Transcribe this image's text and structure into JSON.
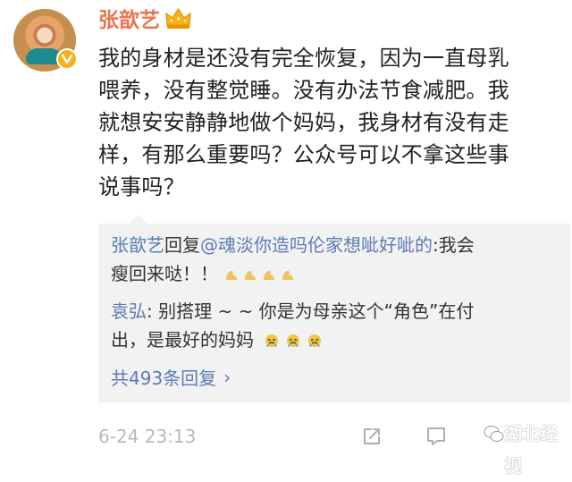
{
  "author": {
    "name": "张歆艺"
  },
  "post": {
    "line1": "我的身材是还没有完全恢复，因为一直母乳",
    "line2": "喂养，没有整觉睡。没有办法节食减肥。我",
    "line3": "就想安安静静地做个妈妈，我身材有没有走",
    "line4": "样，有那么重要吗？公众号可以不拿这些事",
    "line5": "说事吗？"
  },
  "replies": {
    "r1_name": "张歆艺",
    "r1_text": "回复",
    "r1_mention": "@魂淡你造吗伦家想呲好呲的",
    "r1_text2": ":我会",
    "r1_line2": "瘦回来哒！！",
    "r2_name": "袁弘",
    "r2_text": ": 别搭理 ~ ~ 你是为母亲这个“角色”在付",
    "r2_line2": "出，是最好的妈妈",
    "more": "共493条回复"
  },
  "footer": {
    "timestamp": "6-24 23:13"
  },
  "watermark": {
    "text": "湖北经视"
  },
  "colors": {
    "username": "#eb7350",
    "link": "#5b7bb8",
    "reply_bg": "#f2f2f2",
    "timestamp": "#b8b8b8"
  }
}
